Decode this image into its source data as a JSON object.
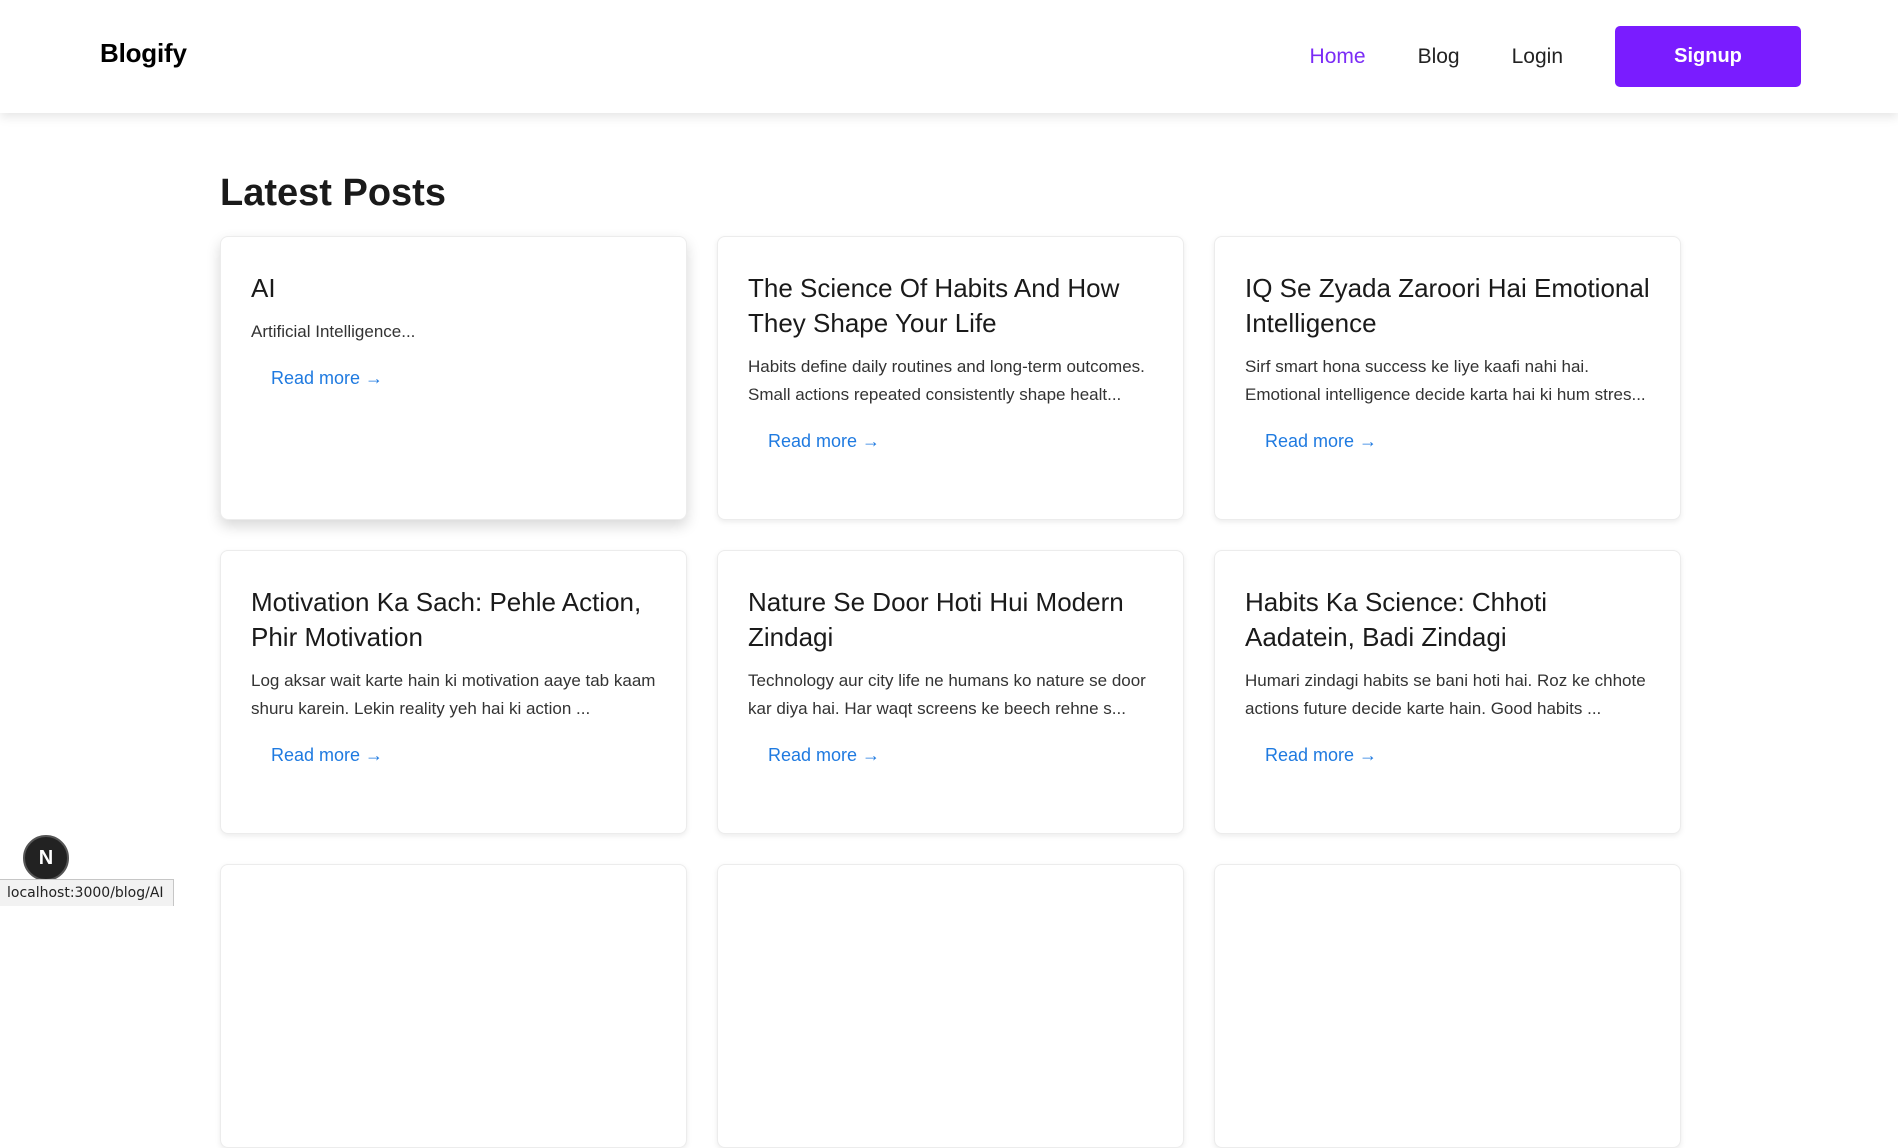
{
  "header": {
    "brand": "Blogify",
    "nav": [
      {
        "label": "Home",
        "active": true
      },
      {
        "label": "Blog",
        "active": false
      },
      {
        "label": "Login",
        "active": false
      }
    ],
    "signup_label": "Signup"
  },
  "main": {
    "title": "Latest Posts",
    "posts": [
      {
        "title": "AI",
        "excerpt": "Artificial Intelligence...",
        "link": "Read more →"
      },
      {
        "title": "The Science Of Habits And How They Shape Your Life",
        "excerpt": "Habits define daily routines and long-term outcomes. Small actions repeated consistently shape healt...",
        "link": "Read more →"
      },
      {
        "title": "IQ Se Zyada Zaroori Hai Emotional Intelligence",
        "excerpt": "Sirf smart hona success ke liye kaafi nahi hai. Emotional intelligence decide karta hai ki hum stres...",
        "link": "Read more →"
      },
      {
        "title": "Motivation Ka Sach: Pehle Action, Phir Motivation",
        "excerpt": "Log aksar wait karte hain ki motivation aaye tab kaam shuru karein. Lekin reality yeh hai ki action ...",
        "link": "Read more →"
      },
      {
        "title": "Nature Se Door Hoti Hui Modern Zindagi",
        "excerpt": "Technology aur city life ne humans ko nature se door kar diya hai. Har waqt screens ke beech rehne s...",
        "link": "Read more →"
      },
      {
        "title": "Habits Ka Science: Chhoti Aadatein, Badi Zindagi",
        "excerpt": "Humari zindagi habits se bani hoti hai. Roz ke chhote actions future decide karte hain. Good habits ...",
        "link": "Read more →"
      }
    ]
  },
  "overlay": {
    "next_badge": "N",
    "status_url": "localhost:3000/blog/AI"
  },
  "colors": {
    "accent": "#7a1cff",
    "link": "#1f7ae0"
  }
}
